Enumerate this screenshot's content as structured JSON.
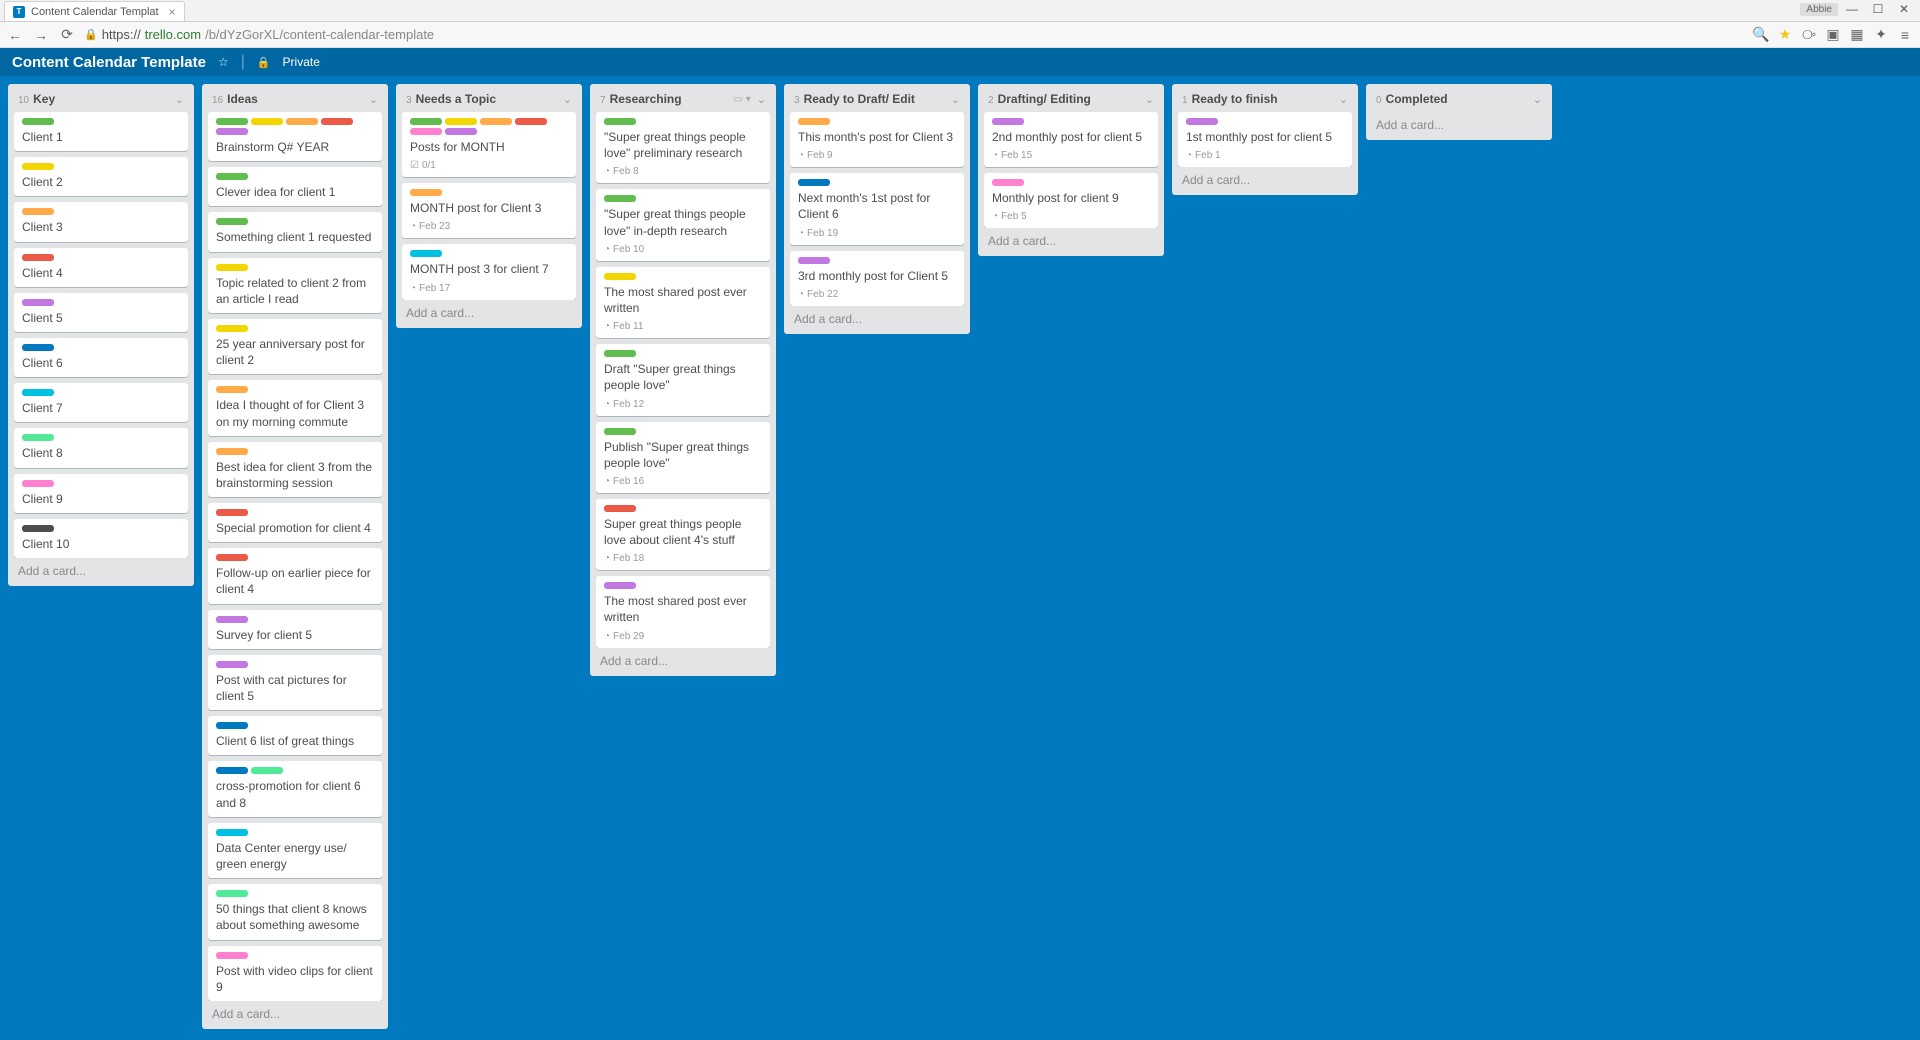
{
  "browser": {
    "tab_title": "Content Calendar Templat",
    "user_badge": "Abbie",
    "url_scheme": "https://",
    "url_host": "trello.com",
    "url_path": "/b/dYzGorXL/content-calendar-template"
  },
  "board_header": {
    "title": "Content Calendar Template",
    "privacy": "Private"
  },
  "add_card_label": "Add a card...",
  "label_colors": {
    "green": "lc-green",
    "yellow": "lc-yellow",
    "orange": "lc-orange",
    "red": "lc-red",
    "purple": "lc-purple",
    "blue": "lc-blue",
    "sky": "lc-sky",
    "lime": "lc-lime",
    "pink": "lc-pink",
    "black": "lc-black"
  },
  "lists": [
    {
      "count": "10",
      "name": "Key",
      "extra": null,
      "cards": [
        {
          "labels": [
            "green"
          ],
          "title": "Client 1"
        },
        {
          "labels": [
            "yellow"
          ],
          "title": "Client 2"
        },
        {
          "labels": [
            "orange"
          ],
          "title": "Client 3"
        },
        {
          "labels": [
            "red"
          ],
          "title": "Client 4"
        },
        {
          "labels": [
            "purple"
          ],
          "title": "Client 5"
        },
        {
          "labels": [
            "blue"
          ],
          "title": "Client 6"
        },
        {
          "labels": [
            "sky"
          ],
          "title": "Client 7"
        },
        {
          "labels": [
            "lime"
          ],
          "title": "Client 8"
        },
        {
          "labels": [
            "pink"
          ],
          "title": "Client 9"
        },
        {
          "labels": [
            "black"
          ],
          "title": "Client 10"
        }
      ]
    },
    {
      "count": "16",
      "name": "Ideas",
      "extra": null,
      "cards": [
        {
          "labels": [
            "green",
            "yellow",
            "orange",
            "red",
            "purple"
          ],
          "title": "Brainstorm Q# YEAR"
        },
        {
          "labels": [
            "green"
          ],
          "title": "Clever idea for client 1"
        },
        {
          "labels": [
            "green"
          ],
          "title": "Something client 1 requested"
        },
        {
          "labels": [
            "yellow"
          ],
          "title": "Topic related to client 2 from an article I read"
        },
        {
          "labels": [
            "yellow"
          ],
          "title": "25 year anniversary post for client 2"
        },
        {
          "labels": [
            "orange"
          ],
          "title": "Idea I thought of for Client 3 on my morning commute"
        },
        {
          "labels": [
            "orange"
          ],
          "title": "Best idea for client 3 from the brainstorming session"
        },
        {
          "labels": [
            "red"
          ],
          "title": "Special promotion for client 4"
        },
        {
          "labels": [
            "red"
          ],
          "title": "Follow-up on earlier piece for client 4"
        },
        {
          "labels": [
            "purple"
          ],
          "title": "Survey for client 5"
        },
        {
          "labels": [
            "purple"
          ],
          "title": "Post with cat pictures for client 5"
        },
        {
          "labels": [
            "blue"
          ],
          "title": "Client 6 list of great things"
        },
        {
          "labels": [
            "blue",
            "lime"
          ],
          "title": "cross-promotion for client 6 and 8"
        },
        {
          "labels": [
            "sky"
          ],
          "title": "Data Center energy use/ green energy"
        },
        {
          "labels": [
            "lime"
          ],
          "title": "50 things that client 8 knows about something awesome"
        },
        {
          "labels": [
            "pink"
          ],
          "title": "Post with video clips for client 9"
        }
      ]
    },
    {
      "count": "3",
      "name": "Needs a Topic",
      "extra": null,
      "cards": [
        {
          "labels": [
            "green",
            "yellow",
            "orange",
            "red",
            "pink",
            "purple"
          ],
          "title": "Posts for MONTH",
          "badge_icon": "checklist",
          "badge_text": "0/1"
        },
        {
          "labels": [
            "orange"
          ],
          "title": "MONTH post for Client 3",
          "badge_icon": "clock",
          "badge_text": "Feb  23"
        },
        {
          "labels": [
            "sky"
          ],
          "title": "MONTH post 3 for client 7",
          "badge_icon": "clock",
          "badge_text": "Feb  17"
        }
      ]
    },
    {
      "count": "7",
      "name": "Researching",
      "extra": "▭ ▾",
      "cards": [
        {
          "labels": [
            "green"
          ],
          "title": "\"Super great things people love\" preliminary research",
          "badge_icon": "clock",
          "badge_text": "Feb  8"
        },
        {
          "labels": [
            "green"
          ],
          "title": "\"Super great things people love\" in-depth research",
          "badge_icon": "clock",
          "badge_text": "Feb  10"
        },
        {
          "labels": [
            "yellow"
          ],
          "title": "The most shared post ever written",
          "badge_icon": "clock",
          "badge_text": "Feb  11"
        },
        {
          "labels": [
            "green"
          ],
          "title": "Draft \"Super great things people love\"",
          "badge_icon": "clock",
          "badge_text": "Feb  12"
        },
        {
          "labels": [
            "green"
          ],
          "title": "Publish \"Super great things people love\"",
          "badge_icon": "clock",
          "badge_text": "Feb  16"
        },
        {
          "labels": [
            "red"
          ],
          "title": "Super great things people love about client 4's stuff",
          "badge_icon": "clock",
          "badge_text": "Feb  18"
        },
        {
          "labels": [
            "purple"
          ],
          "title": "The most shared post ever written",
          "badge_icon": "clock",
          "badge_text": "Feb  29"
        }
      ]
    },
    {
      "count": "3",
      "name": "Ready to Draft/ Edit",
      "extra": null,
      "cards": [
        {
          "labels": [
            "orange"
          ],
          "title": "This month's post for Client 3",
          "badge_icon": "clock",
          "badge_text": "Feb  9"
        },
        {
          "labels": [
            "blue"
          ],
          "title": "Next month's 1st post for Client 6",
          "badge_icon": "clock",
          "badge_text": "Feb  19"
        },
        {
          "labels": [
            "purple"
          ],
          "title": "3rd monthly post for Client 5",
          "badge_icon": "clock",
          "badge_text": "Feb  22"
        }
      ]
    },
    {
      "count": "2",
      "name": "Drafting/ Editing",
      "extra": null,
      "cards": [
        {
          "labels": [
            "purple"
          ],
          "title": "2nd monthly post for client 5",
          "badge_icon": "clock",
          "badge_text": "Feb  15"
        },
        {
          "labels": [
            "pink"
          ],
          "title": "Monthly post for client 9",
          "badge_icon": "clock",
          "badge_text": "Feb  5"
        }
      ]
    },
    {
      "count": "1",
      "name": "Ready to finish",
      "extra": null,
      "cards": [
        {
          "labels": [
            "purple"
          ],
          "title": "1st monthly post for client 5",
          "badge_icon": "clock",
          "badge_text": "Feb  1"
        }
      ]
    },
    {
      "count": "0",
      "name": "Completed",
      "extra": null,
      "cards": []
    }
  ]
}
